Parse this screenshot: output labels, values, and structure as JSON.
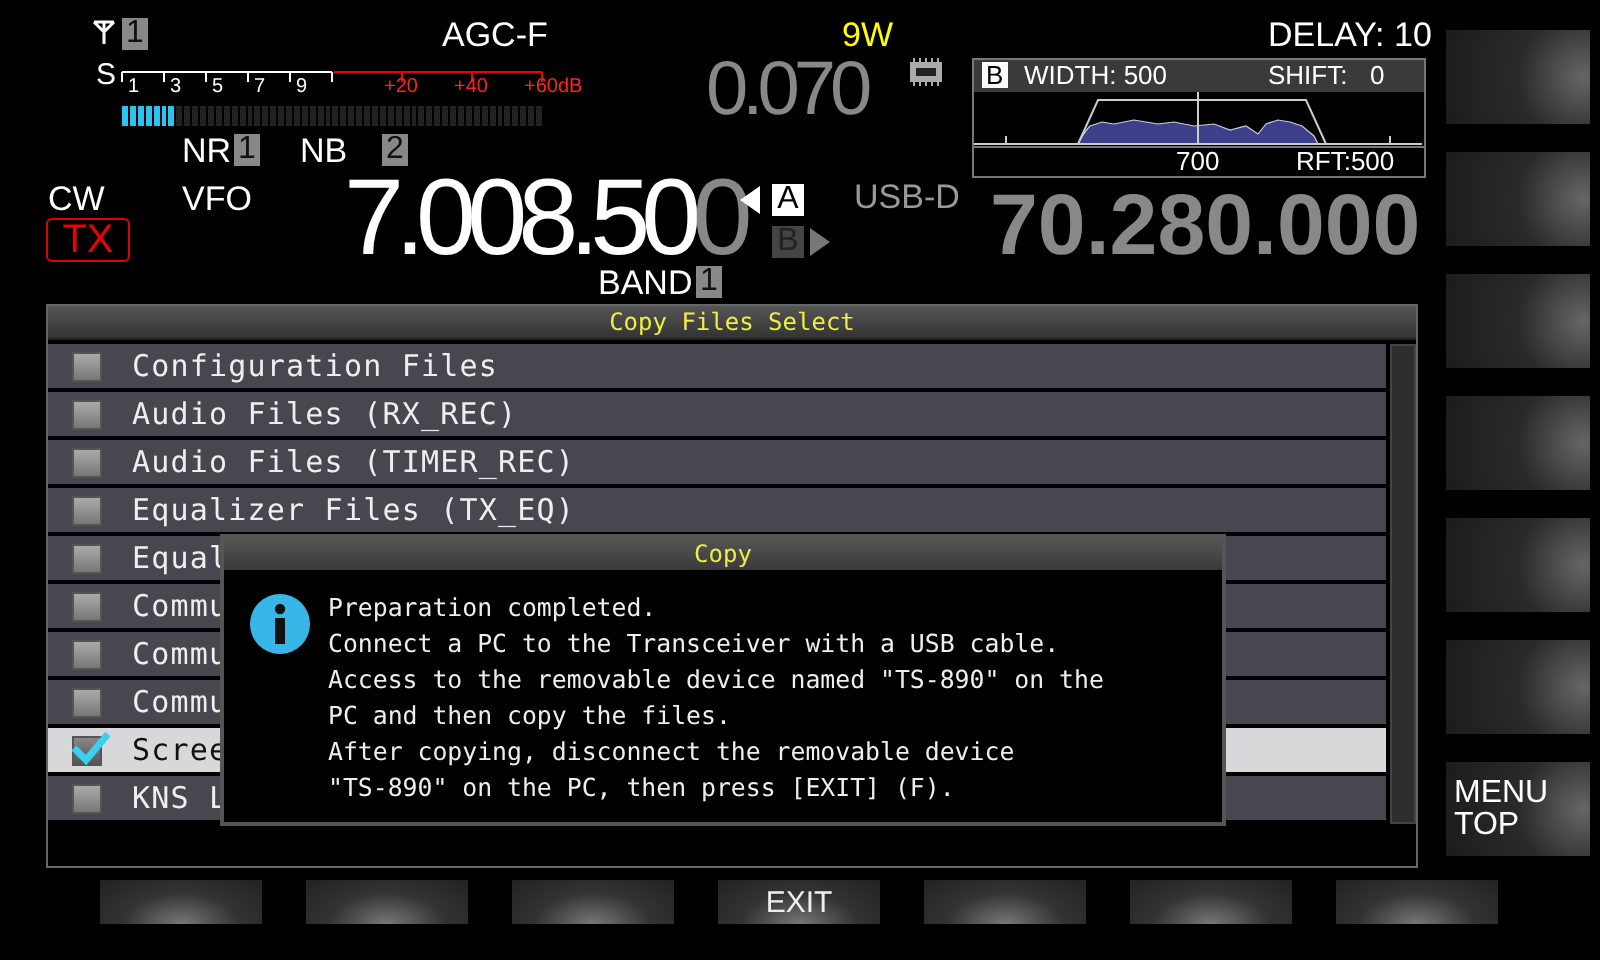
{
  "status": {
    "antenna_number": "1",
    "agc": "AGC-F",
    "power": "9W",
    "delay": "DELAY: 10"
  },
  "s_meter": {
    "s_label": "S",
    "scale": [
      "1",
      "3",
      "5",
      "7",
      "9"
    ],
    "over_scale": [
      "+20",
      "+40",
      "+60dB"
    ],
    "level": 0.13
  },
  "noise": {
    "nr": "NR",
    "nr_value": "1",
    "nb": "NB",
    "nb_value": "2"
  },
  "main": {
    "mode": "CW",
    "vfo": "VFO",
    "tx": "TX",
    "tx_on": true,
    "frequency": "7.008.50",
    "frequency_dim": "0",
    "band": "BAND",
    "band_value": "1"
  },
  "vfos": [
    {
      "label": "A",
      "selected": true
    },
    {
      "label": "B",
      "selected": false
    }
  ],
  "sub": {
    "reading": "0.070",
    "mode": "USB-D",
    "frequency": "70.280.000"
  },
  "filter": {
    "label": "B",
    "width": "WIDTH: 500",
    "shift": "SHIFT:",
    "shift_value": "0",
    "center": "700",
    "rft": "RFT:500"
  },
  "list": {
    "title": "Copy Files Select",
    "items": [
      {
        "label": "Configuration Files",
        "checked": false,
        "selected": false
      },
      {
        "label": "Audio Files (RX_REC)",
        "checked": false,
        "selected": false
      },
      {
        "label": "Audio Files (TIMER_REC)",
        "checked": false,
        "selected": false
      },
      {
        "label": "Equalizer Files (TX_EQ)",
        "checked": false,
        "selected": false
      },
      {
        "label": "Equal",
        "checked": false,
        "selected": false
      },
      {
        "label": "Commu",
        "checked": false,
        "selected": false
      },
      {
        "label": "Commu",
        "checked": false,
        "selected": false
      },
      {
        "label": "Commu",
        "checked": false,
        "selected": false
      },
      {
        "label": "Scree",
        "checked": true,
        "selected": true
      },
      {
        "label": "KNS L",
        "checked": false,
        "selected": false
      }
    ]
  },
  "dialog": {
    "title": "Copy",
    "lines": [
      "Preparation completed.",
      "Connect a PC to the Transceiver with a USB cable.",
      "Access to the removable device named \"TS-890\" on the",
      "PC and then copy the files.",
      "After copying, disconnect the removable device",
      "\"TS-890\" on the PC, then press [EXIT] (F)."
    ]
  },
  "side_menu_key": "MENU TOP",
  "exit_key": "EXIT"
}
